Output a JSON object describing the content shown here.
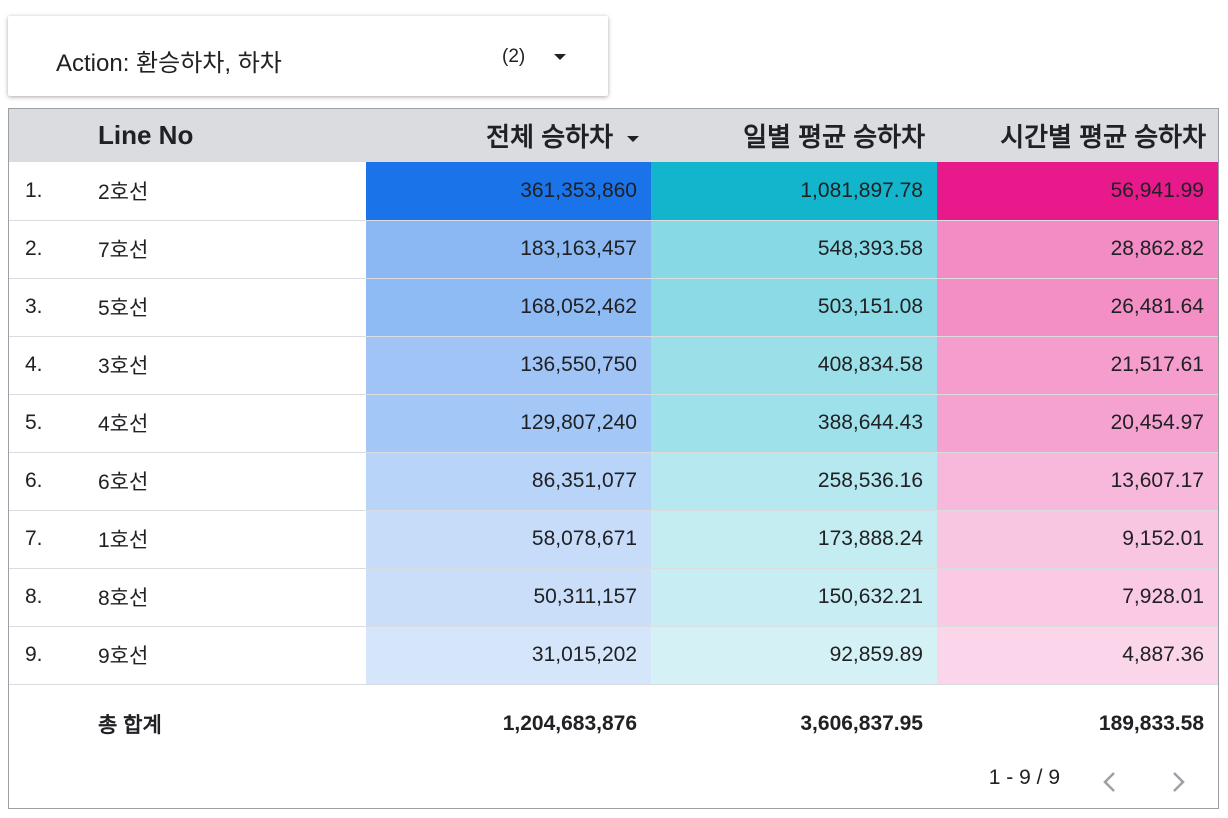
{
  "filter": {
    "label": "Action: 환승하차, 하차",
    "count": "(2)"
  },
  "table": {
    "headers": [
      "",
      "Line No",
      "전체 승하차",
      "일별 평균 승하차",
      "시간별 평균 승하차"
    ],
    "sorted_column": "전체 승하차",
    "rows": [
      {
        "idx": "1.",
        "line": "2호선",
        "total": "361,353,860",
        "daily": "1,081,897.78",
        "hourly": "56,941.99"
      },
      {
        "idx": "2.",
        "line": "7호선",
        "total": "183,163,457",
        "daily": "548,393.58",
        "hourly": "28,862.82"
      },
      {
        "idx": "3.",
        "line": "5호선",
        "total": "168,052,462",
        "daily": "503,151.08",
        "hourly": "26,481.64"
      },
      {
        "idx": "4.",
        "line": "3호선",
        "total": "136,550,750",
        "daily": "408,834.58",
        "hourly": "21,517.61"
      },
      {
        "idx": "5.",
        "line": "4호선",
        "total": "129,807,240",
        "daily": "388,644.43",
        "hourly": "20,454.97"
      },
      {
        "idx": "6.",
        "line": "6호선",
        "total": "86,351,077",
        "daily": "258,536.16",
        "hourly": "13,607.17"
      },
      {
        "idx": "7.",
        "line": "1호선",
        "total": "58,078,671",
        "daily": "173,888.24",
        "hourly": "9,152.01"
      },
      {
        "idx": "8.",
        "line": "8호선",
        "total": "50,311,157",
        "daily": "150,632.21",
        "hourly": "7,928.01"
      },
      {
        "idx": "9.",
        "line": "9호선",
        "total": "31,015,202",
        "daily": "92,859.89",
        "hourly": "4,887.36"
      }
    ],
    "totals": {
      "label": "총 합계",
      "total": "1,204,683,876",
      "daily": "3,606,837.95",
      "hourly": "189,833.58"
    }
  },
  "pagination": {
    "range": "1 - 9 / 9"
  },
  "colors": {
    "total_heat": "#1a73e8",
    "daily_heat": "#12b5cb",
    "hourly_heat": "#e8198b",
    "header_bg": "#dadce0"
  },
  "heatmap_intensity": {
    "total": [
      1.0,
      0.5,
      0.48,
      0.4,
      0.38,
      0.27,
      0.2,
      0.18,
      0.12
    ],
    "daily": [
      1.0,
      0.5,
      0.48,
      0.4,
      0.38,
      0.27,
      0.2,
      0.18,
      0.12
    ],
    "hourly": [
      1.0,
      0.5,
      0.48,
      0.4,
      0.38,
      0.27,
      0.2,
      0.18,
      0.12
    ]
  }
}
